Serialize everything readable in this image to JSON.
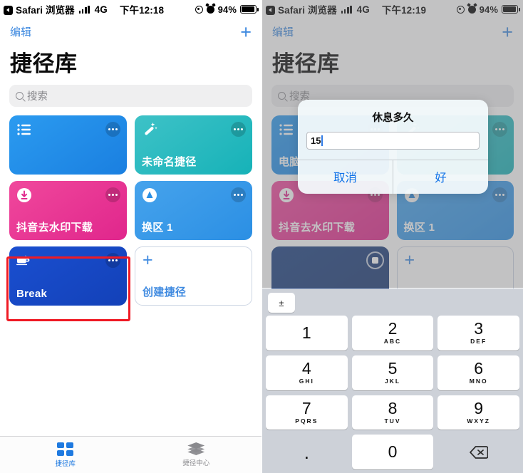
{
  "left": {
    "status": {
      "back_label": "Safari 浏览器",
      "network": "4G",
      "time": "下午12:18",
      "battery_pct": "94%"
    },
    "nav": {
      "edit": "编辑",
      "add": "+"
    },
    "title": "捷径库",
    "search_placeholder": "搜索",
    "cards": [
      {
        "name": "list-card",
        "label": "",
        "icon": "list-icon",
        "color1": "#2b9bf0",
        "color2": "#1a7fe0"
      },
      {
        "name": "unnamed-shortcut-card",
        "label": "未命名捷径",
        "icon": "magic-wand-icon",
        "color1": "#3ec2c7",
        "color2": "#16b2b8"
      },
      {
        "name": "douyin-download-card",
        "label": "抖音去水印下载",
        "icon": "download-icon",
        "color1": "#f0489c",
        "color2": "#e0268c"
      },
      {
        "name": "region-switch-card",
        "label": "换区 1",
        "icon": "appstore-icon",
        "color1": "#46a3ec",
        "color2": "#2b8fe4"
      },
      {
        "name": "break-card",
        "label": "Break",
        "icon": "coffee-cup-icon",
        "color1": "#1a4fd0",
        "color2": "#1341b8"
      },
      {
        "name": "create-shortcut-card",
        "label": "创建捷径",
        "icon": "plus-icon",
        "color1": "#ffffff",
        "color2": "#ffffff"
      }
    ],
    "highlight": {
      "target": "break-card",
      "color": "#ef1a24"
    },
    "tabs": [
      {
        "label": "捷径库",
        "icon": "grid-icon",
        "active": true
      },
      {
        "label": "捷径中心",
        "icon": "layers-icon",
        "active": false
      }
    ]
  },
  "right": {
    "status": {
      "back_label": "Safari 浏览器",
      "network": "4G",
      "time": "下午12:19",
      "battery_pct": "94%"
    },
    "nav": {
      "edit": "编辑",
      "add": "+"
    },
    "title": "捷径库",
    "search_placeholder": "搜索",
    "cards": [
      {
        "name": "computer-card",
        "label": "电脑",
        "icon": "list-icon",
        "color1": "#2b9bf0",
        "color2": "#1a7fe0"
      },
      {
        "name": "unnamed-shortcut-card",
        "label": "",
        "icon": "magic-wand-icon",
        "color1": "#3ec2c7",
        "color2": "#16b2b8"
      },
      {
        "name": "douyin-download-card",
        "label": "抖音去水印下载",
        "icon": "download-icon",
        "color1": "#f0489c",
        "color2": "#e0268c"
      },
      {
        "name": "region-switch-card",
        "label": "换区 1",
        "icon": "appstore-icon",
        "color1": "#46a3ec",
        "color2": "#2b8fe4"
      },
      {
        "name": "break-card-running",
        "label": "",
        "icon": "stop-icon",
        "color1": "#183e82",
        "color2": "#16356f"
      },
      {
        "name": "create-shortcut-card",
        "label": "",
        "icon": "plus-icon",
        "color1": "#ffffff",
        "color2": "#ffffff"
      }
    ],
    "dialog": {
      "title": "休息多久",
      "input_value": "15",
      "cancel": "取消",
      "ok": "好"
    },
    "keypad": {
      "accessory": "±",
      "keys": [
        {
          "num": "1",
          "sub": ""
        },
        {
          "num": "2",
          "sub": "ABC"
        },
        {
          "num": "3",
          "sub": "DEF"
        },
        {
          "num": "4",
          "sub": "GHI"
        },
        {
          "num": "5",
          "sub": "JKL"
        },
        {
          "num": "6",
          "sub": "MNO"
        },
        {
          "num": "7",
          "sub": "PQRS"
        },
        {
          "num": "8",
          "sub": "TUV"
        },
        {
          "num": "9",
          "sub": "WXYZ"
        },
        {
          "num": ".",
          "sub": ""
        },
        {
          "num": "0",
          "sub": ""
        },
        {
          "num": "",
          "sub": ""
        }
      ],
      "delete_icon": "backspace-icon"
    },
    "tabs": [
      {
        "label": "捷径库",
        "icon": "grid-icon",
        "active": true
      },
      {
        "label": "捷径中心",
        "icon": "layers-icon",
        "active": false
      }
    ]
  }
}
